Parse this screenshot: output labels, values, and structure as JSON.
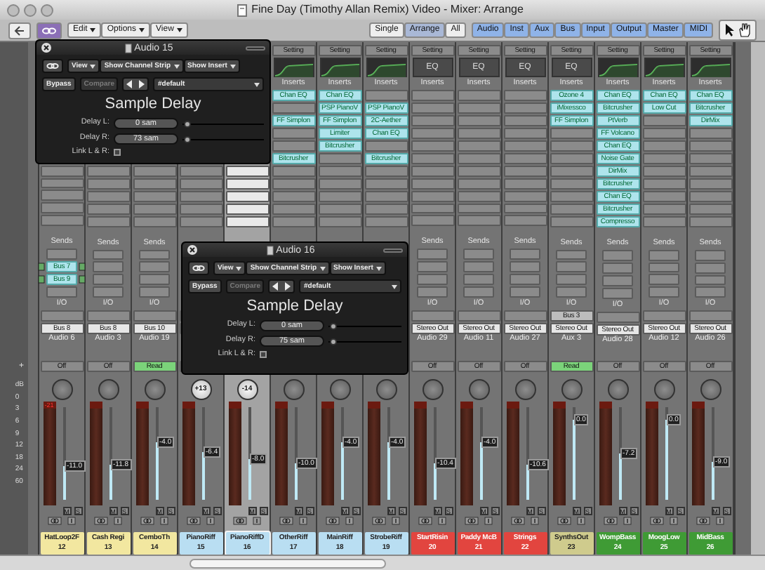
{
  "window": {
    "title": "Fine Day (Timothy Allan Remix) Video - Mixer: Arrange"
  },
  "toolbar": {
    "menus": [
      "Edit",
      "Options",
      "View"
    ],
    "views": [
      {
        "label": "Single",
        "selected": false
      },
      {
        "label": "Arrange",
        "selected": true
      },
      {
        "label": "All",
        "selected": false
      }
    ],
    "filters": [
      {
        "label": "Audio",
        "selected": true
      },
      {
        "label": "Inst",
        "selected": true
      },
      {
        "label": "Aux",
        "selected": true
      },
      {
        "label": "Bus",
        "selected": true
      },
      {
        "label": "Input",
        "selected": true
      },
      {
        "label": "Output",
        "selected": true
      },
      {
        "label": "Master",
        "selected": true
      },
      {
        "label": "MIDI",
        "selected": true
      }
    ]
  },
  "ruler": {
    "button": "+",
    "scale": [
      "dB",
      "0",
      "3",
      "6",
      "9",
      "12",
      "18",
      "24",
      "60"
    ]
  },
  "strips": [
    {
      "selected": false,
      "sends_label": "Sends",
      "sends": [
        {
          "kind": "empty"
        },
        {
          "kind": "bus",
          "name": "Bus 7"
        },
        {
          "kind": "bus",
          "name": "Bus 9"
        },
        {
          "kind": "empty"
        }
      ],
      "io_label": "I/O",
      "output": "Bus 8",
      "track": "Audio 6",
      "automation": {
        "label": "Off",
        "on": false
      },
      "peak": "-21",
      "fader": "-11.0",
      "level": 0.36,
      "mute": "M",
      "solo": "S",
      "name": "HatLoop2F",
      "number": "12",
      "color": "#f2e7a0"
    },
    {
      "selected": false,
      "sends_label": "Sends",
      "io_label": "I/O",
      "output": "Bus 8",
      "track": "Audio 3",
      "automation": {
        "label": "Off",
        "on": false
      },
      "fader": "-11.8",
      "level": 0.38,
      "mute": "M",
      "solo": "S",
      "name": "Cash Regi",
      "number": "13",
      "color": "#f2e7a0"
    },
    {
      "selected": false,
      "sends_label": "Sends",
      "io_label": "I/O",
      "output": "Bus 10",
      "track": "Audio 19",
      "automation": {
        "label": "Read",
        "on": true
      },
      "fader": "-4.0",
      "level": 0.62,
      "mute": "M",
      "solo": "S",
      "name": "CemboTh",
      "number": "14",
      "color": "#f2e7a0"
    },
    {
      "selected": false,
      "pan": "+13",
      "fader": "-6.4",
      "level": 0.52,
      "mute": "M",
      "solo": "S",
      "name": "PianoRiff",
      "number": "15",
      "color": "#b9def2"
    },
    {
      "selected": true,
      "pan": "-14",
      "fader": "-8.0",
      "level": 0.44,
      "mute": "M",
      "solo": "S",
      "name": "PianoRiffD",
      "number": "16",
      "color": "#b9def2"
    },
    {
      "selected": false,
      "setting": "Setting",
      "eq": {
        "kind": "graph"
      },
      "inserts_label": "Inserts",
      "inserts": [
        {
          "kind": "plugin",
          "name": "Chan EQ"
        },
        {
          "kind": "empty"
        },
        {
          "kind": "plugin",
          "name": "FF Simplon"
        },
        {
          "kind": "empty"
        },
        {
          "kind": "empty"
        },
        {
          "kind": "plugin",
          "name": "Bitcrusher"
        }
      ],
      "fader": "-10.0",
      "level": 0.4,
      "mute": "M",
      "solo": "S",
      "name": "OtherRiff",
      "number": "17",
      "color": "#b9def2"
    },
    {
      "selected": false,
      "setting": "Setting",
      "eq": {
        "kind": "graph"
      },
      "inserts_label": "Inserts",
      "inserts": [
        {
          "kind": "plugin",
          "name": "Chan EQ"
        },
        {
          "kind": "plugin",
          "name": "PSP PianoV"
        },
        {
          "kind": "plugin",
          "name": "FF Simplon"
        },
        {
          "kind": "plugin",
          "name": "Limiter"
        },
        {
          "kind": "plugin",
          "name": "Bitcrusher"
        }
      ],
      "fader": "-4.0",
      "level": 0.62,
      "mute": "M",
      "solo": "S",
      "name": "MainRiff",
      "number": "18",
      "color": "#b9def2"
    },
    {
      "selected": false,
      "setting": "Setting",
      "eq": {
        "kind": "graph"
      },
      "inserts_label": "Inserts",
      "inserts": [
        {
          "kind": "empty"
        },
        {
          "kind": "plugin",
          "name": "PSP PianoV"
        },
        {
          "kind": "plugin",
          "name": "2C-Aether"
        },
        {
          "kind": "plugin",
          "name": "Chan EQ"
        },
        {
          "kind": "empty"
        },
        {
          "kind": "plugin",
          "name": "Bitcrusher"
        }
      ],
      "fader": "-4.0",
      "level": 0.62,
      "mute": "M",
      "solo": "S",
      "name": "StrobeRiff",
      "number": "19",
      "color": "#b9def2"
    },
    {
      "selected": false,
      "setting": "Setting",
      "eq": {
        "kind": "label",
        "label": "EQ"
      },
      "inserts_label": "Inserts",
      "sends_label": "Sends",
      "io_label": "I/O",
      "output": "Stereo Out",
      "track": "Audio 29",
      "automation": {
        "label": "Off",
        "on": false
      },
      "fader": "-10.4",
      "level": 0.4,
      "mute": "M",
      "solo": "S",
      "name": "StartRisin",
      "number": "20",
      "color": "#e2453f"
    },
    {
      "selected": false,
      "setting": "Setting",
      "eq": {
        "kind": "label",
        "label": "EQ"
      },
      "inserts_label": "Inserts",
      "sends_label": "Sends",
      "io_label": "I/O",
      "output": "Stereo Out",
      "track": "Audio 11",
      "automation": {
        "label": "Off",
        "on": false
      },
      "fader": "-4.0",
      "level": 0.62,
      "mute": "M",
      "solo": "S",
      "name": "Paddy McB",
      "number": "21",
      "color": "#e2453f"
    },
    {
      "selected": false,
      "setting": "Setting",
      "eq": {
        "kind": "label",
        "label": "EQ"
      },
      "inserts_label": "Inserts",
      "sends_label": "Sends",
      "io_label": "I/O",
      "output": "Stereo Out",
      "track": "Audio 27",
      "automation": {
        "label": "Off",
        "on": false
      },
      "fader": "-10.6",
      "level": 0.38,
      "mute": "M",
      "solo": "S",
      "name": "Strings",
      "number": "22",
      "color": "#e2453f"
    },
    {
      "selected": false,
      "setting": "Setting",
      "eq": {
        "kind": "label",
        "label": "EQ"
      },
      "inserts_label": "Inserts",
      "inserts": [
        {
          "kind": "plugin",
          "name": "Ozone 4"
        },
        {
          "kind": "plugin",
          "name": "iMixessco"
        },
        {
          "kind": "plugin",
          "name": "FF Simplon"
        }
      ],
      "sends_label": "Sends",
      "io_label": "I/O",
      "input": "Bus 3",
      "output": "Stereo Out",
      "track": "Aux 3",
      "automation": {
        "label": "Read",
        "on": true
      },
      "fader": "0.0",
      "level": 0.86,
      "mute": "M",
      "solo": "S",
      "name": "SynthsOut",
      "number": "23",
      "color": "#cfcb8d"
    },
    {
      "selected": false,
      "setting": "Setting",
      "eq": {
        "kind": "graph"
      },
      "inserts_label": "Inserts",
      "inserts": [
        {
          "kind": "plugin",
          "name": "Chan EQ"
        },
        {
          "kind": "plugin",
          "name": "Bitcrusher"
        },
        {
          "kind": "plugin",
          "name": "PtVerb"
        },
        {
          "kind": "plugin",
          "name": "FF Volcano"
        },
        {
          "kind": "plugin",
          "name": "Chan EQ"
        },
        {
          "kind": "plugin",
          "name": "Noise Gate"
        },
        {
          "kind": "plugin",
          "name": "DirMix"
        },
        {
          "kind": "plugin",
          "name": "Bitcrusher"
        },
        {
          "kind": "plugin",
          "name": "Chan EQ"
        },
        {
          "kind": "plugin",
          "name": "Bitcrusher"
        },
        {
          "kind": "plugin",
          "name": "Compresso"
        }
      ],
      "sends_label": "Sends",
      "io_label": "I/O",
      "output": "Stereo Out",
      "track": "Audio 28",
      "automation": {
        "label": "Off",
        "on": false
      },
      "fader": "-7.2",
      "level": 0.5,
      "mute": "M",
      "solo": "S",
      "name": "WompBass",
      "number": "24",
      "color": "#3f9b35"
    },
    {
      "selected": false,
      "setting": "Setting",
      "eq": {
        "kind": "graph"
      },
      "inserts_label": "Inserts",
      "inserts": [
        {
          "kind": "plugin",
          "name": "Chan EQ"
        },
        {
          "kind": "plugin",
          "name": "Low Cut"
        }
      ],
      "sends_label": "Sends",
      "io_label": "I/O",
      "output": "Stereo Out",
      "track": "Audio 12",
      "automation": {
        "label": "Off",
        "on": false
      },
      "fader": "0.0",
      "level": 0.86,
      "mute": "M",
      "solo": "S",
      "name": "MoogLow",
      "number": "25",
      "color": "#3f9b35"
    },
    {
      "selected": false,
      "setting": "Setting",
      "eq": {
        "kind": "graph"
      },
      "inserts_label": "Inserts",
      "inserts": [
        {
          "kind": "plugin",
          "name": "Chan EQ"
        },
        {
          "kind": "plugin",
          "name": "Bitcrusher"
        },
        {
          "kind": "plugin",
          "name": "DirMix"
        }
      ],
      "sends_label": "Sends",
      "io_label": "I/O",
      "output": "Stereo Out",
      "track": "Audio 26",
      "automation": {
        "label": "Off",
        "on": false
      },
      "fader": "-9.0",
      "level": 0.42,
      "mute": "M",
      "solo": "S",
      "name": "MidBass",
      "number": "26",
      "color": "#3f9b35"
    }
  ],
  "plugin_windows": [
    {
      "title": "Audio 15",
      "menus": [
        "View",
        "Show Channel Strip",
        "Show Insert"
      ],
      "bypass": {
        "label": "Bypass",
        "disabled": false
      },
      "compare": {
        "label": "Compare",
        "disabled": true
      },
      "preset": "#default",
      "plugin": "Sample Delay",
      "params": [
        {
          "label": "Delay L:",
          "value": "0 sam",
          "level": 0
        },
        {
          "label": "Delay R:",
          "value": "73 sam",
          "level": 0
        }
      ],
      "link": {
        "label": "Link L & R:",
        "checked": false
      }
    },
    {
      "title": "Audio 16",
      "menus": [
        "View",
        "Show Channel Strip",
        "Show Insert"
      ],
      "bypass": {
        "label": "Bypass",
        "disabled": false
      },
      "compare": {
        "label": "Compare",
        "disabled": true
      },
      "preset": "#default",
      "plugin": "Sample Delay",
      "params": [
        {
          "label": "Delay L:",
          "value": "0 sam",
          "level": 0
        },
        {
          "label": "Delay R:",
          "value": "75 sam",
          "level": 0
        }
      ],
      "link": {
        "label": "Link L & R:",
        "checked": false
      }
    }
  ]
}
